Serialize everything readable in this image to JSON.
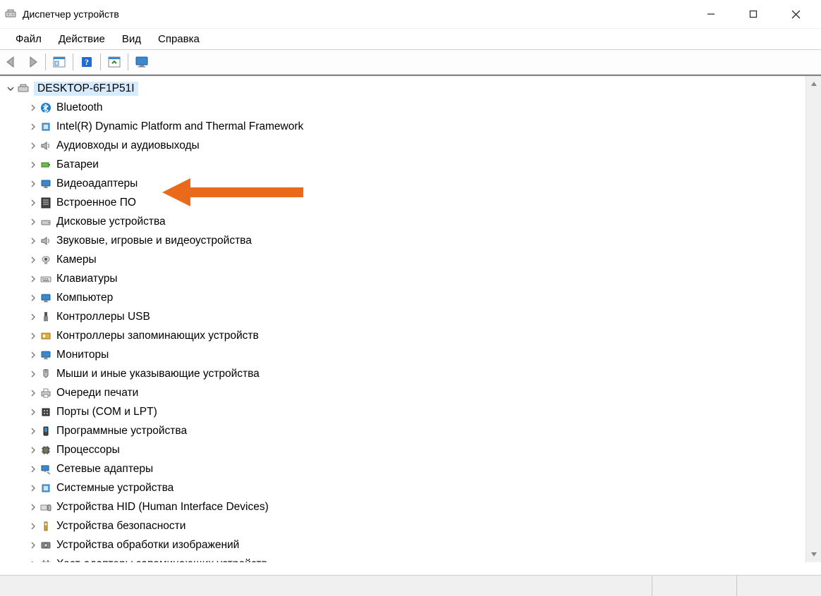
{
  "window": {
    "title": "Диспетчер устройств"
  },
  "menu": {
    "file": "Файл",
    "action": "Действие",
    "view": "Вид",
    "help": "Справка"
  },
  "tree": {
    "root": "DESKTOP-6F1P51I",
    "items": [
      "Bluetooth",
      "Intel(R) Dynamic Platform and Thermal Framework",
      "Аудиовходы и аудиовыходы",
      "Батареи",
      "Видеоадаптеры",
      "Встроенное ПО",
      "Дисковые устройства",
      "Звуковые, игровые и видеоустройства",
      "Камеры",
      "Клавиатуры",
      "Компьютер",
      "Контроллеры USB",
      "Контроллеры запоминающих устройств",
      "Мониторы",
      "Мыши и иные указывающие устройства",
      "Очереди печати",
      "Порты (COM и LPT)",
      "Программные устройства",
      "Процессоры",
      "Сетевые адаптеры",
      "Системные устройства",
      "Устройства HID (Human Interface Devices)",
      "Устройства безопасности",
      "Устройства обработки изображений",
      "Хост-адаптеры запоминающих устройств"
    ]
  },
  "annotation": {
    "arrow_target": "Видеоадаптеры",
    "arrow_color": "#e86a1a"
  }
}
